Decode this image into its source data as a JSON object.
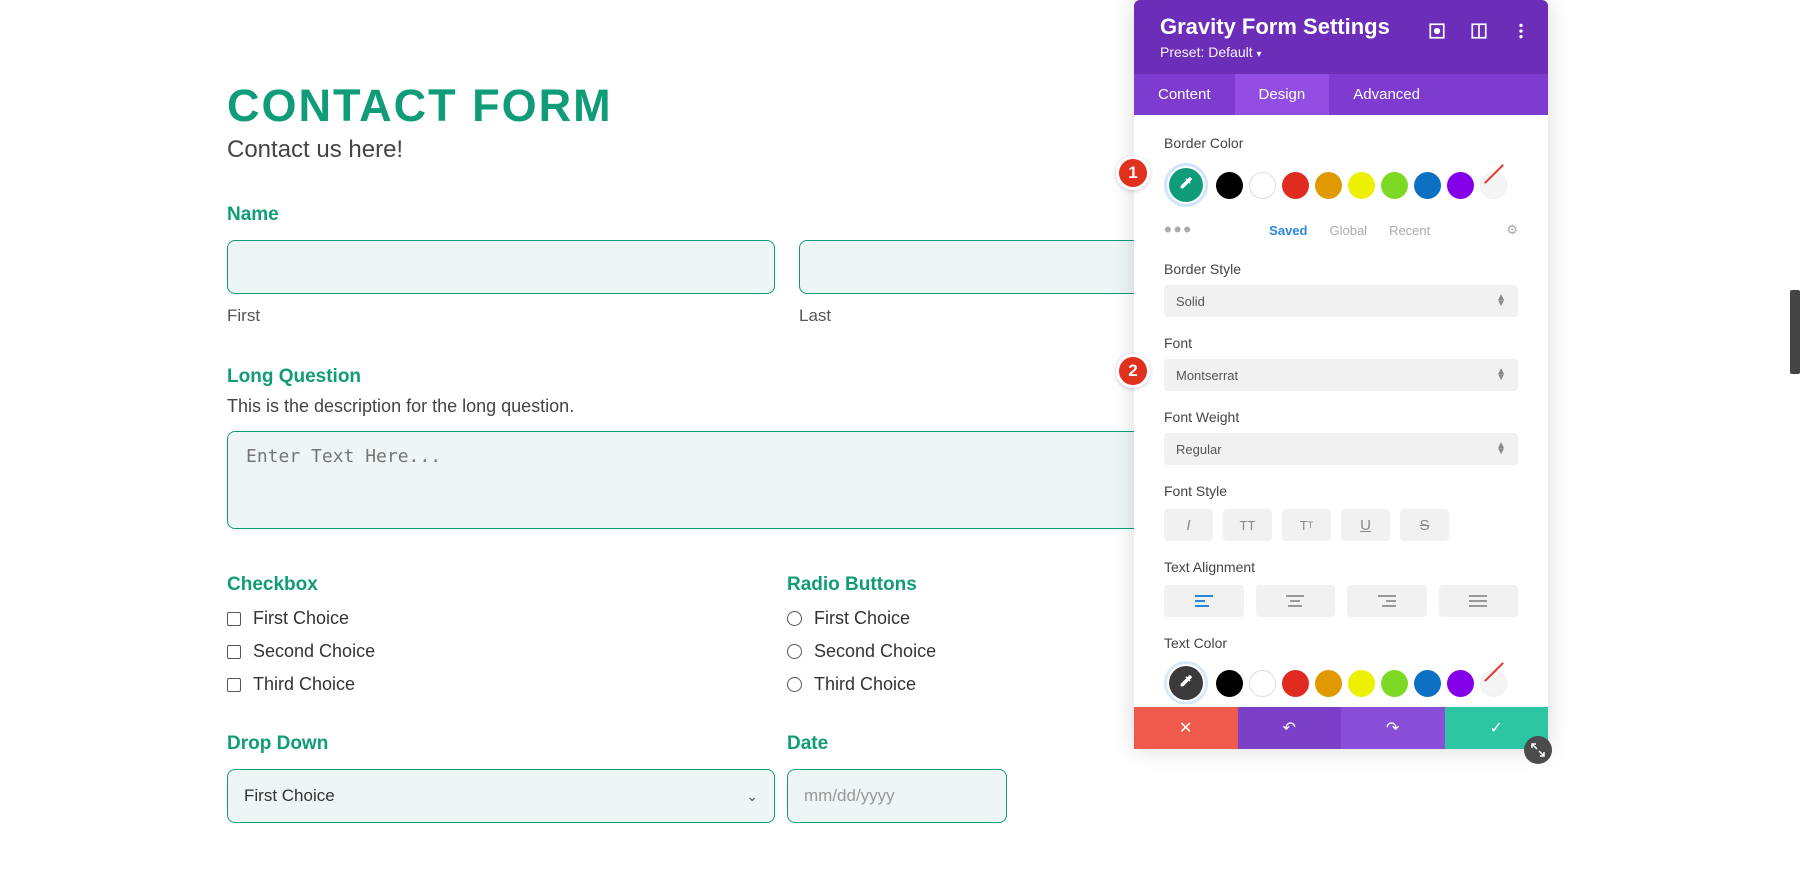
{
  "form": {
    "title": "CONTACT FORM",
    "subtitle": "Contact us here!",
    "name_label": "Name",
    "first_label": "First",
    "last_label": "Last",
    "long_question_label": "Long Question",
    "long_question_desc": "This is the description for the long question.",
    "textarea_placeholder": "Enter Text Here...",
    "checkbox_label": "Checkbox",
    "checkbox_options": [
      "First Choice",
      "Second Choice",
      "Third Choice"
    ],
    "radio_label": "Radio Buttons",
    "radio_options": [
      "First Choice",
      "Second Choice",
      "Third Choice"
    ],
    "dropdown_label": "Drop Down",
    "dropdown_selected": "First Choice",
    "date_label": "Date",
    "date_placeholder": "mm/dd/yyyy"
  },
  "panel": {
    "title": "Gravity Form Settings",
    "preset_label": "Preset: Default",
    "tabs": {
      "content": "Content",
      "design": "Design",
      "advanced": "Advanced"
    },
    "border_color_label": "Border Color",
    "swatch_tabs": {
      "saved": "Saved",
      "global": "Global",
      "recent": "Recent"
    },
    "border_style_label": "Border Style",
    "border_style_value": "Solid",
    "font_label": "Font",
    "font_value": "Montserrat",
    "font_weight_label": "Font Weight",
    "font_weight_value": "Regular",
    "font_style_label": "Font Style",
    "text_alignment_label": "Text Alignment",
    "text_color_label": "Text Color",
    "colors": {
      "selected": "#109c78",
      "palette": [
        "#000000",
        "#ffffff",
        "#e02b20",
        "#e09900",
        "#edf000",
        "#7cda24",
        "#0c71c3",
        "#8300e9"
      ]
    }
  },
  "badges": {
    "one": "1",
    "two": "2"
  }
}
